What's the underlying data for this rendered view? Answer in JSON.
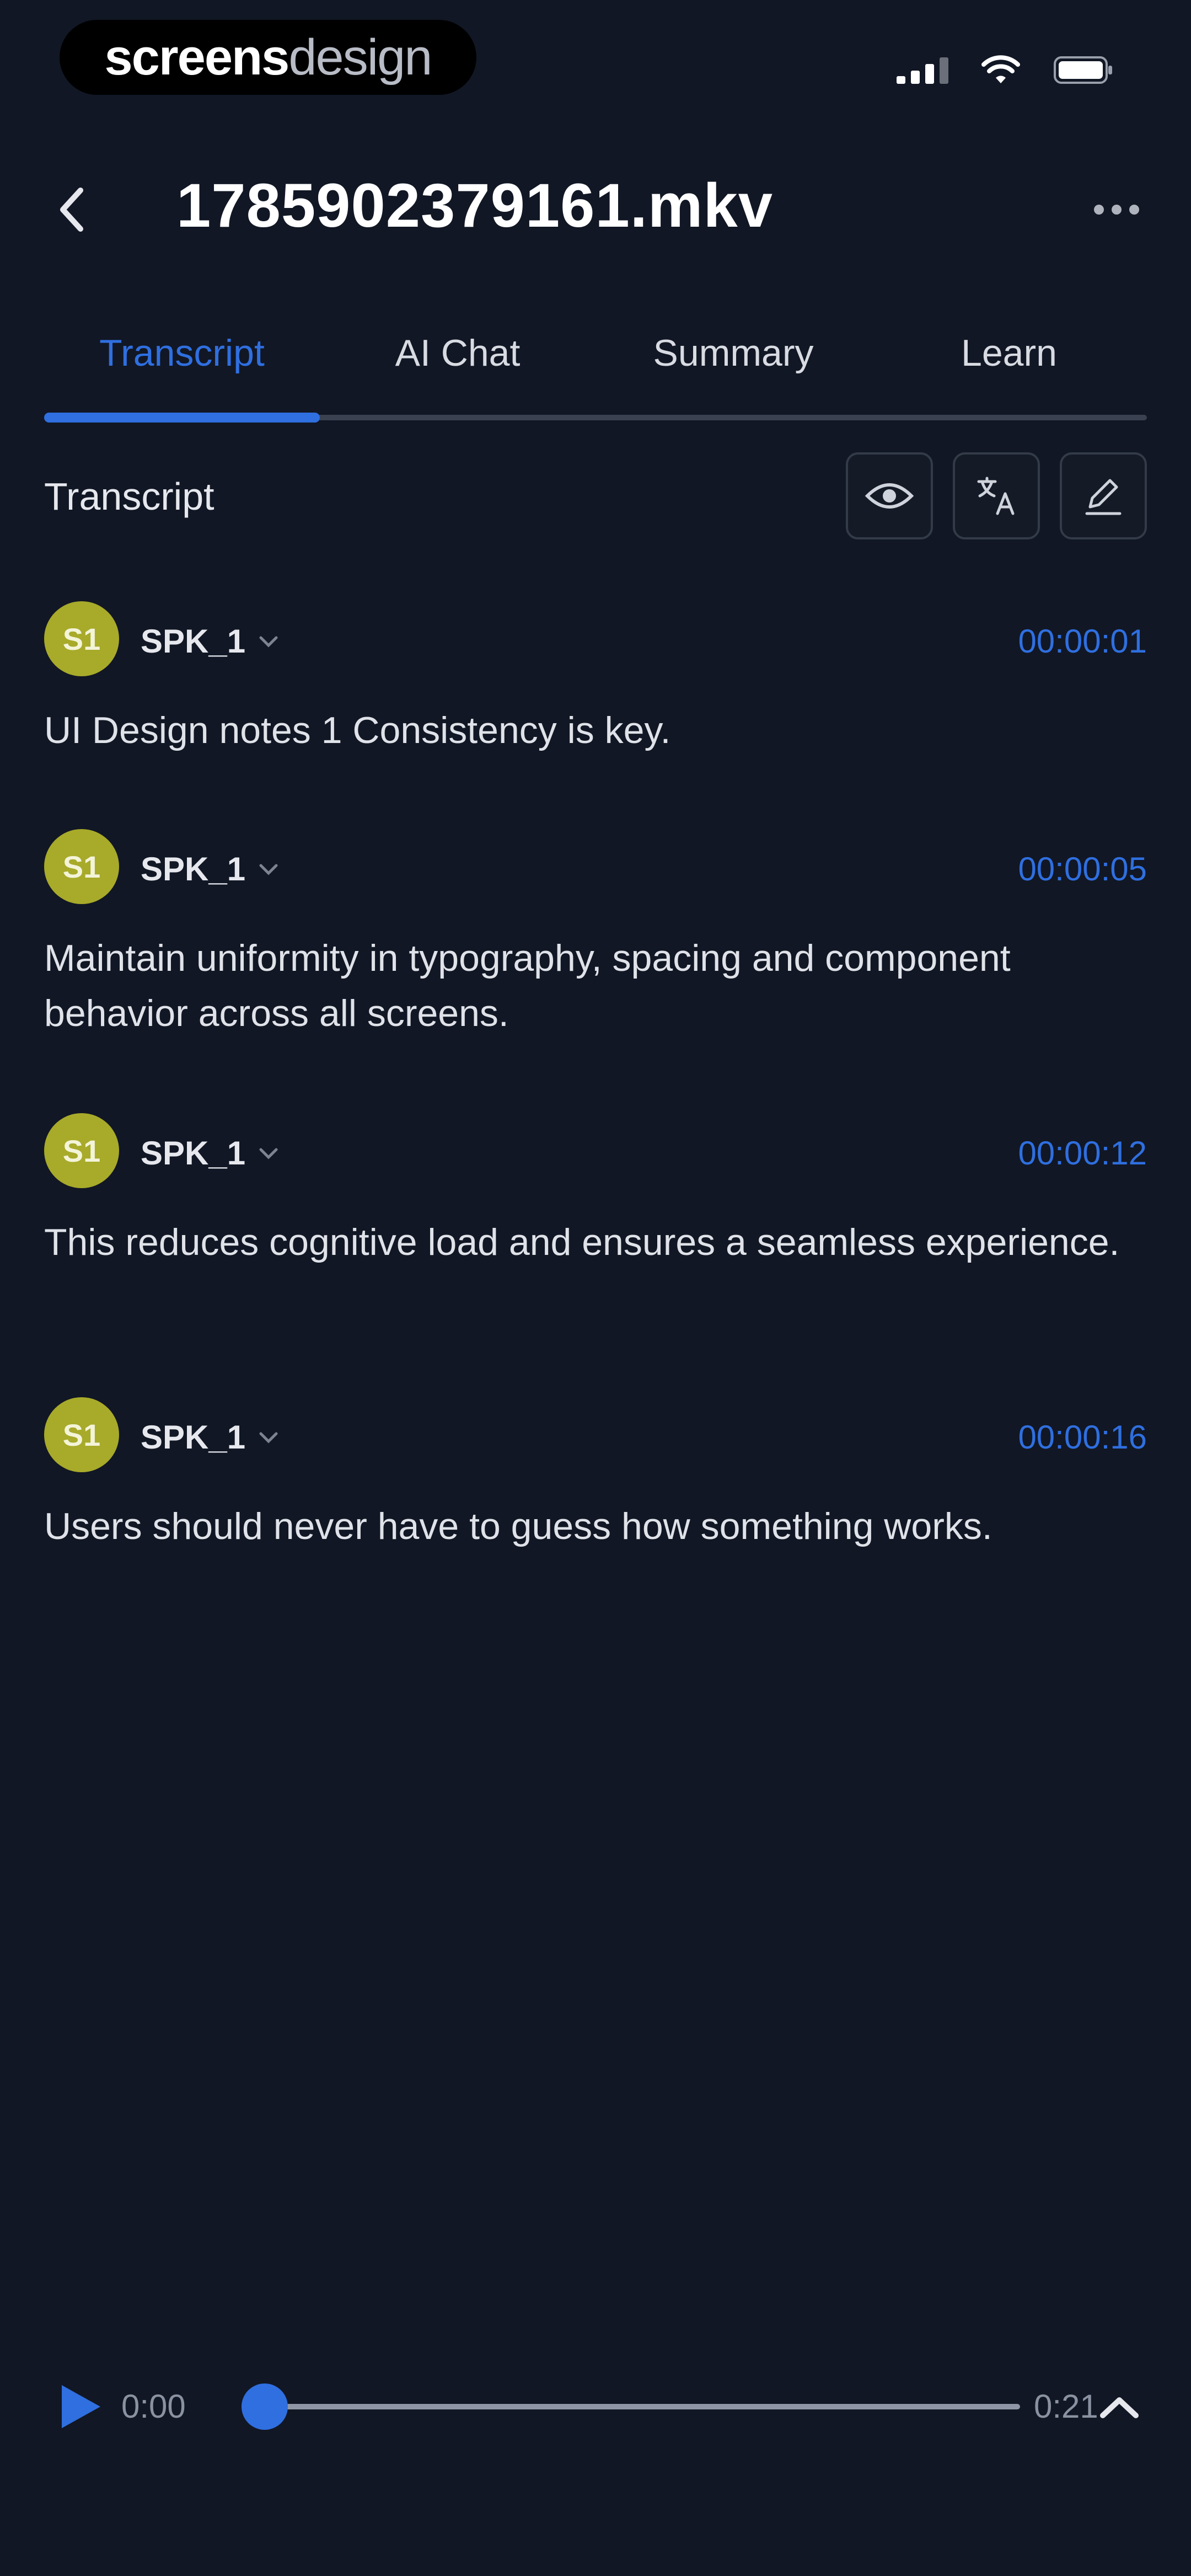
{
  "watermark": {
    "bold": "screens",
    "light": "design"
  },
  "header": {
    "title": "1785902379161.mkv"
  },
  "tabs": [
    {
      "label": "Transcript",
      "active": true
    },
    {
      "label": "AI Chat",
      "active": false
    },
    {
      "label": "Summary",
      "active": false
    },
    {
      "label": "Learn",
      "active": false
    }
  ],
  "section": {
    "title": "Transcript",
    "tools": [
      "eye-icon",
      "translate-icon",
      "edit-icon"
    ]
  },
  "transcript": [
    {
      "avatar": "S1",
      "speaker": "SPK_1",
      "time": "00:00:01",
      "text": "UI Design notes 1 Consistency is key."
    },
    {
      "avatar": "S1",
      "speaker": "SPK_1",
      "time": "00:00:05",
      "text": "Maintain uniformity in typography, spacing and component behavior across all screens."
    },
    {
      "avatar": "S1",
      "speaker": "SPK_1",
      "time": "00:00:12",
      "text": "This reduces cognitive load and ensures a seamless experience."
    },
    {
      "avatar": "S1",
      "speaker": "SPK_1",
      "time": "00:00:16",
      "text": "Users should never have to guess how something works."
    }
  ],
  "player": {
    "current": "0:00",
    "total": "0:21",
    "progress": 0
  },
  "colors": {
    "background": "#111724",
    "accent": "#2f6fe0",
    "avatar": "#a8aa2a"
  }
}
